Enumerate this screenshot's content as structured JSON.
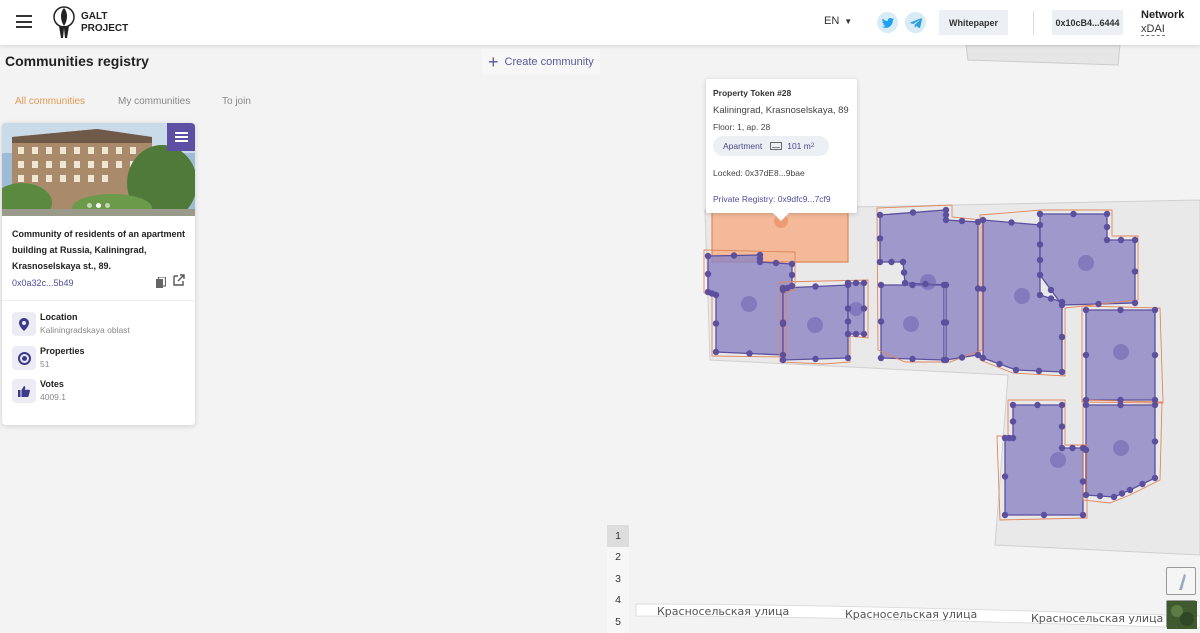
{
  "header": {
    "logo_line1": "GALT",
    "logo_line2": "PROJECT",
    "language": "EN",
    "whitepaper": "Whitepaper",
    "wallet": "0x10cB4...6444",
    "network_label": "Network",
    "network_value": "xDAI",
    "colors": {
      "accent": "#e29a53",
      "purple": "#5d4fa3",
      "twitter": "#1da1f2"
    }
  },
  "page": {
    "title": "Communities registry",
    "create_label": "Create community"
  },
  "tabs": [
    "All communities",
    "My communities",
    "To join"
  ],
  "card": {
    "title": "Community of residents of an apartment building at Russia, Kaliningrad, Krasnoselskaya st., 89.",
    "address": "0x0a32c...5b49",
    "stats": [
      {
        "label": "Location",
        "value": "Kaliningradskaya oblast",
        "icon": "location-pin-icon"
      },
      {
        "label": "Properties",
        "value": "51",
        "icon": "target-icon"
      },
      {
        "label": "Votes",
        "value": "4009.1",
        "icon": "thumbs-up-icon"
      }
    ]
  },
  "popup": {
    "title": "Property Token #28",
    "address": "Kaliningrad, Krasnoselskaya, 89",
    "floor": "Floor: 1, ap. 28",
    "type": "Apartment",
    "area": "101 m",
    "area_sup": "2",
    "locked": "Locked: 0x37dE8...9bae",
    "registry": "Private Registry: 0x9dfc9...7cf9"
  },
  "pagination": [
    "1",
    "2",
    "3",
    "4",
    "5"
  ],
  "streets": [
    "Красносельская улица",
    "Красносельская улица",
    "Красносельская улица"
  ]
}
